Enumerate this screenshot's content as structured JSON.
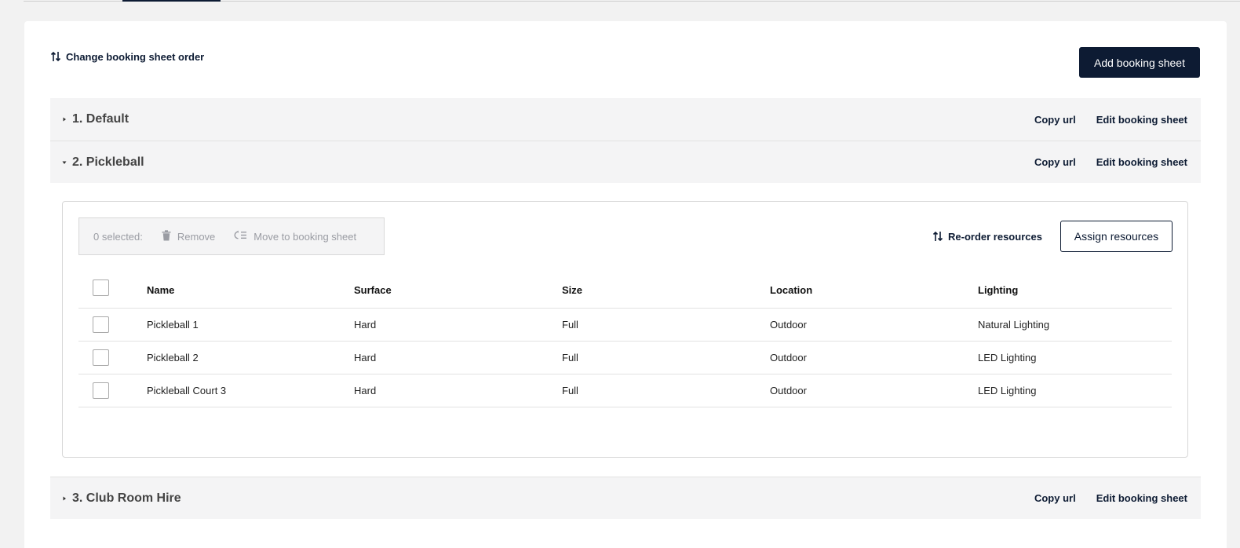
{
  "header": {
    "change_order_label": "Change booking sheet order",
    "add_sheet_label": "Add booking sheet"
  },
  "sheets": [
    {
      "title": "1. Default",
      "expanded": false,
      "copy_url": "Copy url",
      "edit": "Edit booking sheet"
    },
    {
      "title": "2. Pickleball",
      "expanded": true,
      "copy_url": "Copy url",
      "edit": "Edit booking sheet"
    },
    {
      "title": "3. Club Room Hire",
      "expanded": false,
      "copy_url": "Copy url",
      "edit": "Edit booking sheet"
    }
  ],
  "panel": {
    "selected_label": "0 selected:",
    "remove_label": "Remove",
    "move_label": "Move to booking sheet",
    "reorder_label": "Re-order resources",
    "assign_label": "Assign resources"
  },
  "table": {
    "columns": [
      "Name",
      "Surface",
      "Size",
      "Location",
      "Lighting"
    ],
    "rows": [
      [
        "Pickleball 1",
        "Hard",
        "Full",
        "Outdoor",
        "Natural Lighting"
      ],
      [
        "Pickleball 2",
        "Hard",
        "Full",
        "Outdoor",
        "LED Lighting"
      ],
      [
        "Pickleball Court 3",
        "Hard",
        "Full",
        "Outdoor",
        "LED Lighting"
      ]
    ]
  },
  "colors": {
    "primary": "#0d1b33",
    "row_bg": "#f4f4f5",
    "disabled_text": "#9a9ca3"
  }
}
